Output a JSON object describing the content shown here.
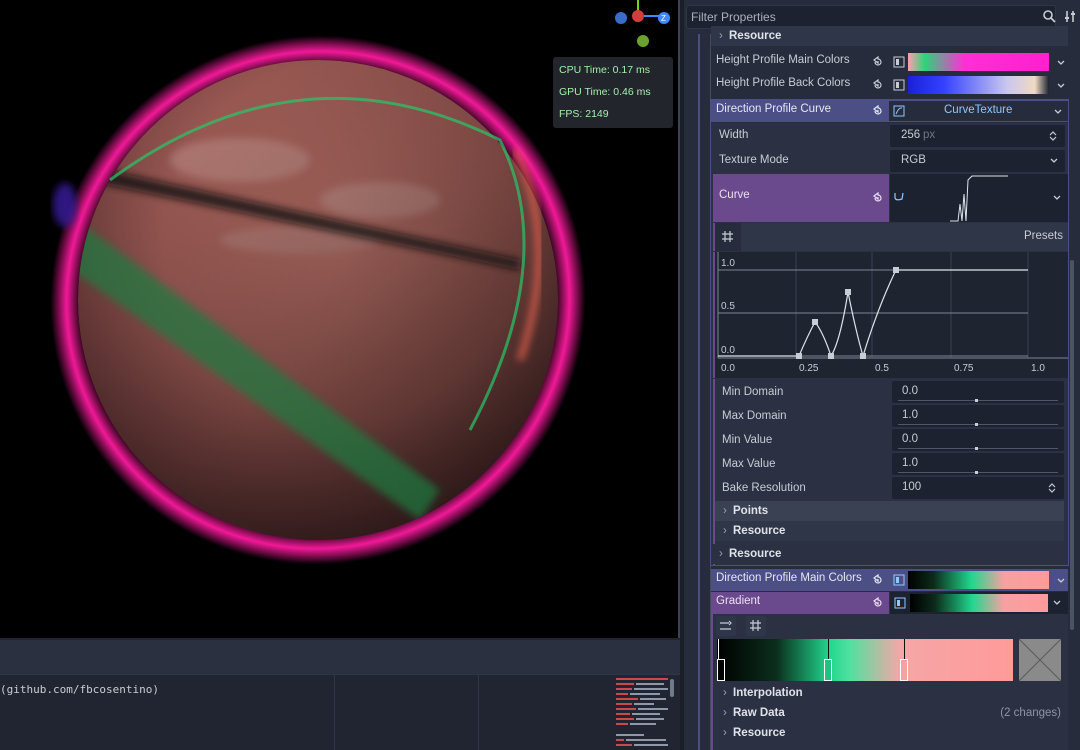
{
  "viewport": {
    "perf": {
      "cpu": "CPU Time: 0.17 ms",
      "gpu": "GPU Time: 0.46 ms",
      "fps": "FPS: 2149"
    },
    "gizmo_z": "Z"
  },
  "code": {
    "line": "(github.com/fbcosentino)"
  },
  "inspector": {
    "filter_placeholder": "Filter Properties",
    "resource_top": "Resource",
    "height_main_colors": "Height Profile Main Colors",
    "height_back_colors": "Height Profile Back Colors",
    "direction_profile_curve": "Direction Profile Curve",
    "curve_texture": "CurveTexture",
    "width_label": "Width",
    "width_value": "256",
    "width_unit": "px",
    "texture_mode_label": "Texture Mode",
    "texture_mode_value": "RGB",
    "curve_label": "Curve",
    "presets": "Presets",
    "curve_ticks_y": [
      "1.0",
      "0.5",
      "0.0"
    ],
    "curve_ticks_x": [
      "0.0",
      "0.25",
      "0.5",
      "0.75",
      "1.0"
    ],
    "min_domain_label": "Min Domain",
    "min_domain_value": "0.0",
    "max_domain_label": "Max Domain",
    "max_domain_value": "1.0",
    "min_value_label": "Min Value",
    "min_value_value": "0.0",
    "max_value_label": "Max Value",
    "max_value_value": "1.0",
    "bake_resolution_label": "Bake Resolution",
    "bake_resolution_value": "100",
    "points": "Points",
    "resource_inner": "Resource",
    "resource_outer": "Resource",
    "direction_main_colors": "Direction Profile Main Colors",
    "gradient_label": "Gradient",
    "interpolation": "Interpolation",
    "raw_data": "Raw Data",
    "raw_data_changes": "(2 changes)",
    "resource_bottom": "Resource"
  },
  "colors": {
    "accent_blue": "#4b4f86",
    "accent_purple": "#6a4a8d",
    "perf_text": "#a5efac",
    "curve_texture_text": "#8fc8ff"
  },
  "icons": [
    "search-icon",
    "tools-icon",
    "revert-icon",
    "dropdown-arrow-icon",
    "gradient-texture-icon",
    "curve-texture-icon",
    "curve-icon",
    "snap-grid-icon",
    "reverse-icon"
  ]
}
